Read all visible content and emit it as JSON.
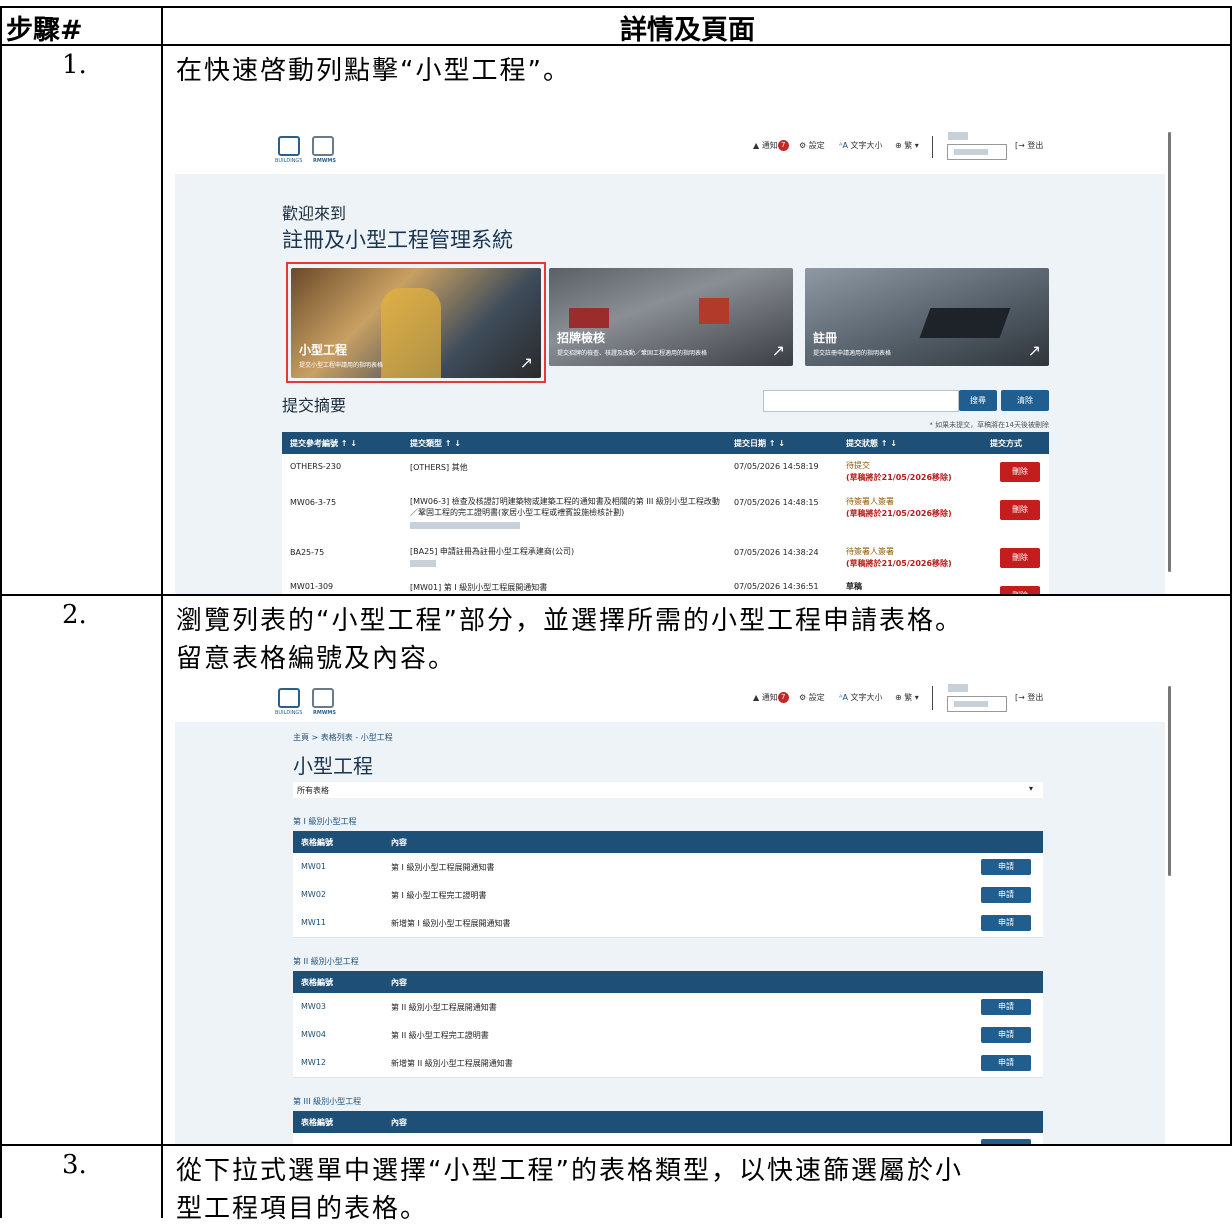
{
  "table": {
    "col1_header": "步驟#",
    "col2_header": "詳情及頁面"
  },
  "steps": [
    {
      "num": "1.",
      "text": "在快速啓動列點擊“小型工程”。"
    },
    {
      "num": "2.",
      "text_line1": "瀏覽列表的“小型工程”部分，並選擇所需的小型工程申請表格。",
      "text_line2": "留意表格編號及內容。"
    },
    {
      "num": "3.",
      "text_line1": "從下拉式選單中選擇“小型工程”的表格類型，以快速篩選屬於小",
      "text_line2": "型工程項目的表格。"
    }
  ],
  "topbar": {
    "logo_caption": "BUILDINGS",
    "logo2_caption": "RMWMS",
    "notif_count": "7",
    "notify_label": "通知",
    "settings_label": "設定",
    "fontsize_label": "文字大小",
    "lang_label": "繁",
    "logout_label": "登出"
  },
  "shot1": {
    "welcome": "歡迎來到",
    "system_name": "註冊及小型工程管理系統",
    "cards": [
      {
        "title": "小型工程",
        "sub": "提交小型工程申請用的指明表格"
      },
      {
        "title": "招牌檢核",
        "sub": "提交招牌的檢查、核證及改動／鞏固工程適用的指明表格"
      },
      {
        "title": "註冊",
        "sub": "提交註冊申請適用的指明表格"
      }
    ],
    "summary_title": "提交摘要",
    "search_btn": "搜尋",
    "clear_btn": "清除",
    "note": "* 如果未提交，草稿將在14天後被刪除",
    "headers": [
      "提交參考編號 ↑ ↓",
      "提交類型 ↑ ↓",
      "提交日期 ↑ ↓",
      "提交狀態 ↑ ↓",
      "提交方式"
    ],
    "rows": [
      {
        "ref": "OTHERS-230",
        "type": "[OTHERS] 其他",
        "type2": "",
        "date": "07/05/2026 14:58:19",
        "status": "待提交",
        "status2": "(草稿將於21/05/2026移除)",
        "btn": "刪除"
      },
      {
        "ref": "MW06-3-75",
        "type": "[MW06-3] 檢查及核證訂明建築物或建築工程的通知書及相關的第 III 級別小型工程改動",
        "type2": "／鞏固工程的完工證明書(家居小型工程或禮賓設施檢核計劃)",
        "date": "07/05/2026 14:48:15",
        "status": "待簽署人簽署",
        "status2": "(草稿將於21/05/2026移除)",
        "btn": "刪除"
      },
      {
        "ref": "BA25-75",
        "type": "[BA25] 申請註冊為註冊小型工程承建商(公司)",
        "type2": "",
        "date": "07/05/2026 14:38:24",
        "status": "待簽署人簽署",
        "status2": "(草稿將於21/05/2026移除)",
        "btn": "刪除"
      },
      {
        "ref": "MW01-309",
        "type": "[MW01] 第 I 級別小型工程展開通知書",
        "type2": "",
        "date": "07/05/2026 14:36:51",
        "status": "草稿",
        "status2": "",
        "btn": "刪除"
      }
    ]
  },
  "shot2": {
    "breadcrumb": "主頁 > 表格列表 - 小型工程",
    "page_title": "小型工程",
    "filter_value": "所有表格",
    "col_form": "表格編號",
    "col_content": "內容",
    "apply": "申請",
    "groups": [
      {
        "title": "第 I 級別小型工程",
        "rows": [
          {
            "code": "MW01",
            "content": "第 I 級別小型工程展開通知書"
          },
          {
            "code": "MW02",
            "content": "第 I 級小型工程完工證明書"
          },
          {
            "code": "MW11",
            "content": "新增第 I 級別小型工程展開通知書"
          }
        ]
      },
      {
        "title": "第 II 級別小型工程",
        "rows": [
          {
            "code": "MW03",
            "content": "第 II 級別小型工程展開通知書"
          },
          {
            "code": "MW04",
            "content": "第 II 級小型工程完工證明書"
          },
          {
            "code": "MW12",
            "content": "新增第 II 級別小型工程展開通知書"
          }
        ]
      },
      {
        "title": "第 III 級別小型工程",
        "rows": []
      }
    ]
  }
}
